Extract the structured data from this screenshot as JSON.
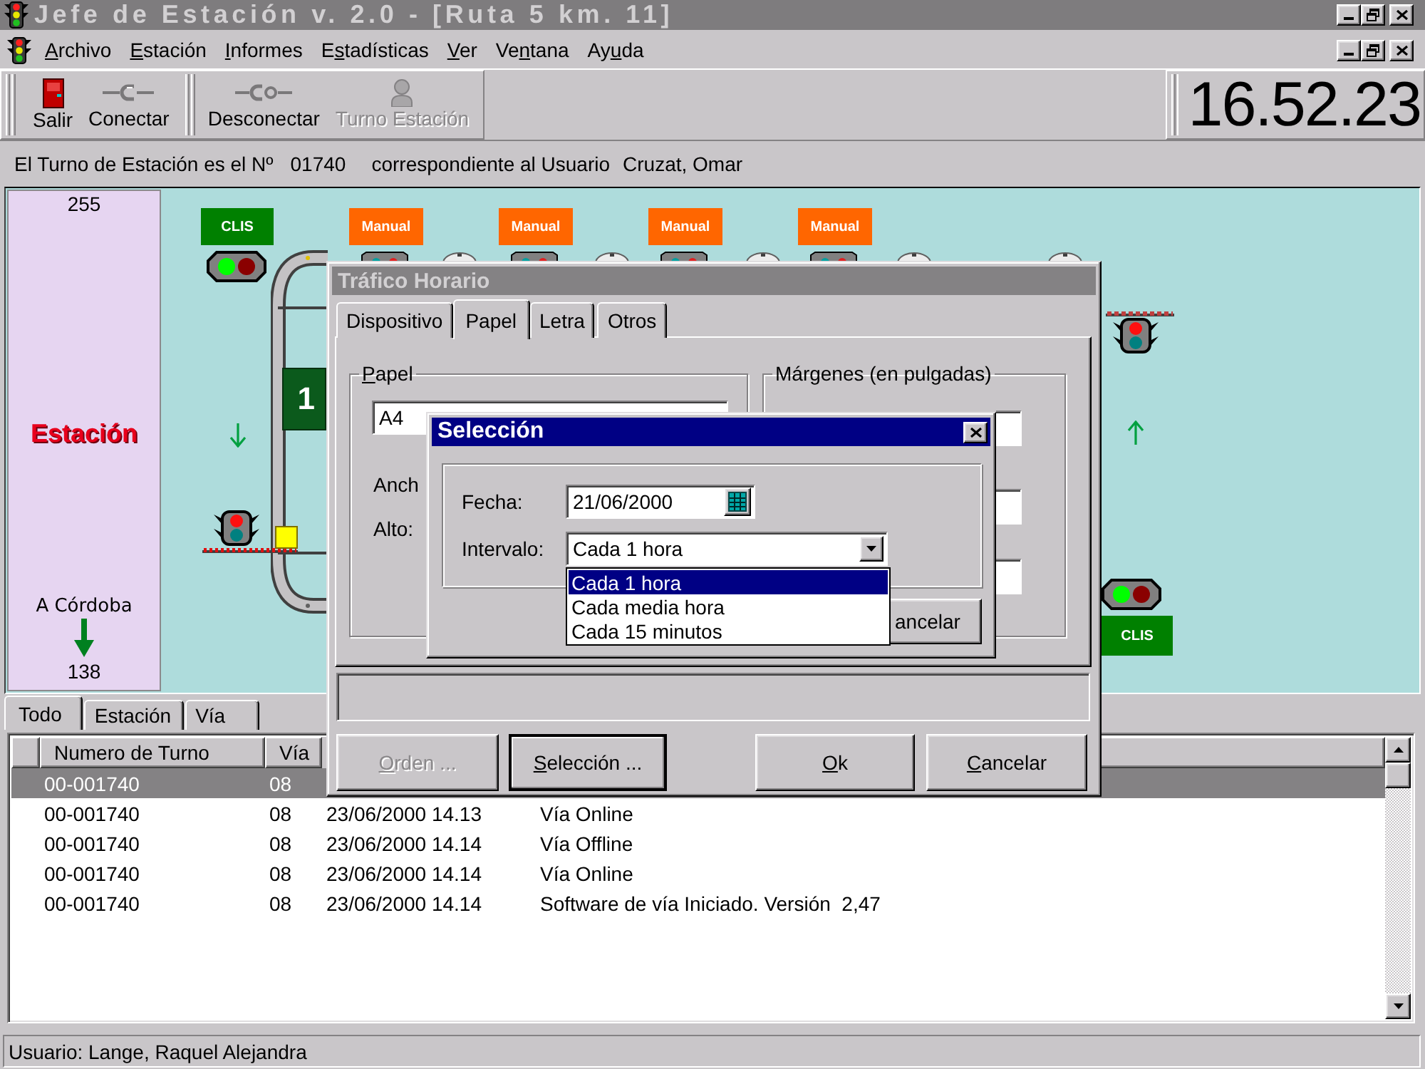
{
  "window": {
    "title": "Jefe de Estación v. 2.0 - [Ruta 5 km. 11]"
  },
  "menu": [
    {
      "key": "A",
      "after": "rchivo"
    },
    {
      "key": "E",
      "after": "stación"
    },
    {
      "key": "I",
      "after": "nformes"
    },
    {
      "before": "E",
      "key": "s",
      "after": "tadísticas"
    },
    {
      "key": "V",
      "after": "er"
    },
    {
      "before": "Ve",
      "key": "n",
      "after": "tana"
    },
    {
      "before": "Ay",
      "key": "u",
      "after": "da"
    }
  ],
  "toolbar": {
    "groups": [
      [
        {
          "label": "Salir",
          "disabled": false
        },
        {
          "label": "Conectar",
          "disabled": false
        }
      ],
      [
        {
          "label": "Desconectar",
          "disabled": false
        },
        {
          "label": "Turno Estación",
          "disabled": true
        }
      ]
    ],
    "clock": "16.52.23"
  },
  "info_line": {
    "shift_label": "El Turno de Estación es el Nº",
    "shift_number": "01740",
    "user_label": "correspondiente al Usuario",
    "user_name": "Cruzat, Omar"
  },
  "station_panel": {
    "top_count": "255",
    "title": "Estación",
    "direction": "A Córdoba",
    "bottom_count": "138"
  },
  "diagram": {
    "tags": [
      {
        "label": "CLIS",
        "color": "#008000"
      },
      {
        "label": "Manual",
        "color": "#ff6600"
      },
      {
        "label": "Manual",
        "color": "#ff6600"
      },
      {
        "label": "Manual",
        "color": "#ff6600"
      },
      {
        "label": "Manual",
        "color": "#ff6600"
      },
      {
        "label": "CLIS",
        "color": "#008000"
      }
    ],
    "block": "1",
    "signals": [
      {
        "kind": "horizontal",
        "clear": true
      },
      {
        "kind": "hanging",
        "clear": false
      },
      {
        "kind": "hanging",
        "clear": false
      },
      {
        "kind": "horizontal",
        "clear": true
      }
    ]
  },
  "log_tabs": [
    {
      "label": "Todo",
      "selected": true
    },
    {
      "label": "Estación",
      "selected": false
    },
    {
      "label": "Vía",
      "selected": false
    }
  ],
  "log_table": {
    "columns": [
      "Numero de Turno",
      "Vía"
    ],
    "rows": [
      {
        "selected": true,
        "cells": [
          "00-001740",
          "08"
        ]
      },
      {
        "selected": false,
        "cells": [
          "00-001740",
          "08",
          "23/06/2000 14.13",
          "Vía Online"
        ]
      },
      {
        "selected": false,
        "cells": [
          "00-001740",
          "08",
          "23/06/2000 14.14",
          "Vía Offline"
        ]
      },
      {
        "selected": false,
        "cells": [
          "00-001740",
          "08",
          "23/06/2000 14.14",
          "Vía Online"
        ]
      },
      {
        "selected": false,
        "cells": [
          "00-001740",
          "08",
          "23/06/2000 14.14",
          "Software de vía Iniciado. Versión  2,47"
        ]
      }
    ]
  },
  "status_bar": "Usuario: Lange, Raquel Alejandra",
  "traffic_dialog": {
    "title": "Tráfico Horario",
    "active": false,
    "tabs": [
      {
        "label": "Dispositivo",
        "selected": false
      },
      {
        "label": "Papel",
        "selected": true
      },
      {
        "label": "Letra",
        "selected": false
      },
      {
        "label": "Otros",
        "selected": false
      }
    ],
    "paper_group": {
      "label": {
        "key": "P",
        "after": "apel"
      },
      "size": "A4",
      "width_label": "Anch",
      "height_label": "Alto:"
    },
    "margins_group": {
      "label": "Márgenes (en pulgadas)"
    },
    "buttons": [
      {
        "key": "O",
        "after": "rden ...",
        "disabled": true,
        "default": false
      },
      {
        "key": "S",
        "after": "elección ...",
        "disabled": false,
        "default": true
      },
      {
        "key": "O",
        "after": "k",
        "disabled": false,
        "default": false
      },
      {
        "key": "C",
        "after": "ancelar",
        "disabled": false,
        "default": false
      }
    ]
  },
  "selection_dialog": {
    "title": "Selección",
    "active": true,
    "date_label": "Fecha:",
    "date": "21/06/2000",
    "interval_label": "Intervalo:",
    "interval": "Cada 1 hora",
    "options": [
      {
        "label": "Cada 1 hora",
        "selected": true
      },
      {
        "label": "Cada media hora",
        "selected": false
      },
      {
        "label": "Cada 15 minutos",
        "selected": false
      }
    ],
    "buttons": [
      {
        "label": "ancelar"
      }
    ]
  }
}
